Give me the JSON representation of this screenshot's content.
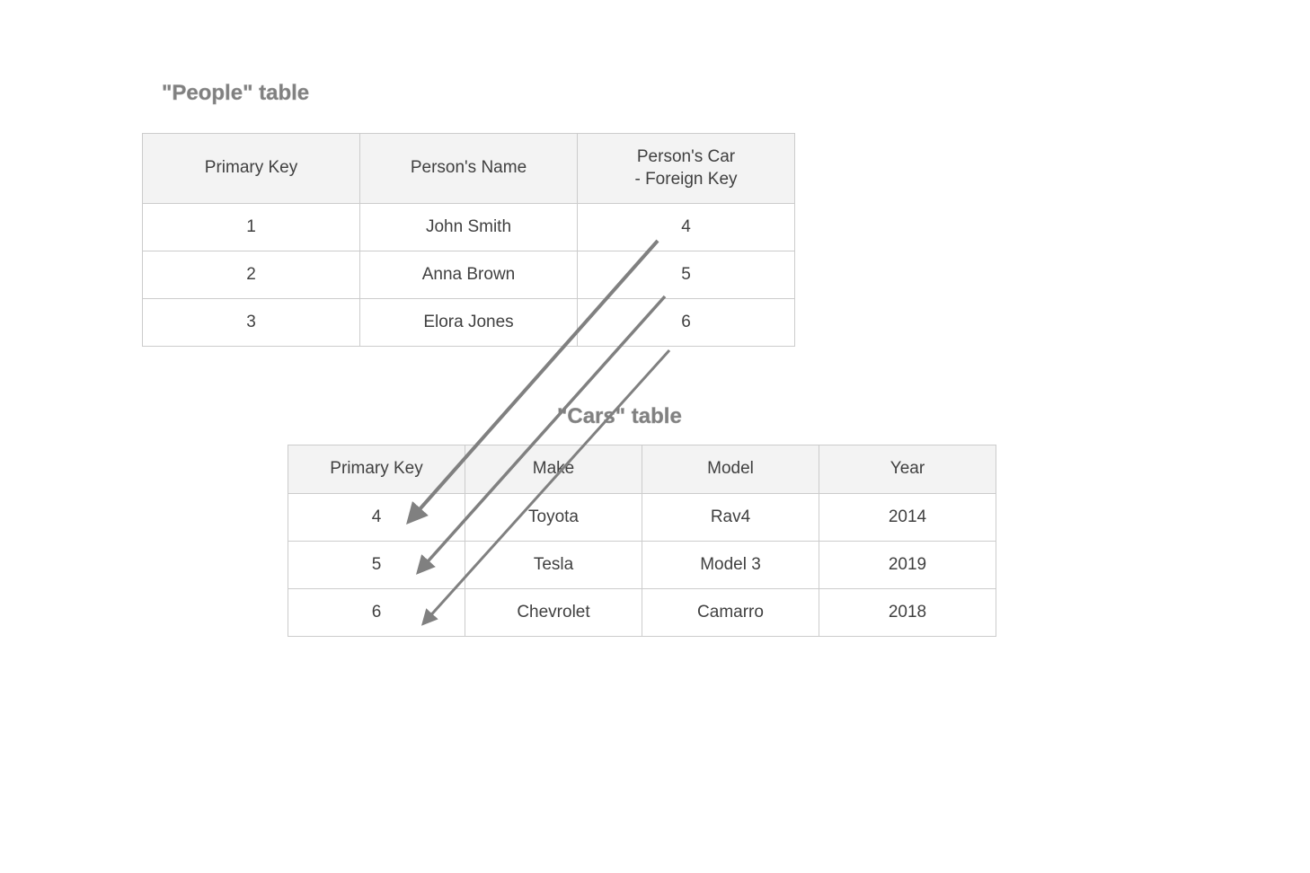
{
  "people": {
    "title": "\"People\" table",
    "headers": {
      "col0": "Primary Key",
      "col1": "Person's Name",
      "col2": "Person's Car\n- Foreign Key"
    },
    "rows": [
      {
        "pk": "1",
        "name": "John Smith",
        "carfk": "4"
      },
      {
        "pk": "2",
        "name": "Anna Brown",
        "carfk": "5"
      },
      {
        "pk": "3",
        "name": "Elora Jones",
        "carfk": "6"
      }
    ]
  },
  "cars": {
    "title": "\"Cars\" table",
    "headers": {
      "col0": "Primary Key",
      "col1": "Make",
      "col2": "Model",
      "col3": "Year"
    },
    "rows": [
      {
        "pk": "4",
        "make": "Toyota",
        "model": "Rav4",
        "year": "2014"
      },
      {
        "pk": "5",
        "make": "Tesla",
        "model": "Model 3",
        "year": "2019"
      },
      {
        "pk": "6",
        "make": "Chevrolet",
        "model": "Camarro",
        "year": "2018"
      }
    ]
  }
}
